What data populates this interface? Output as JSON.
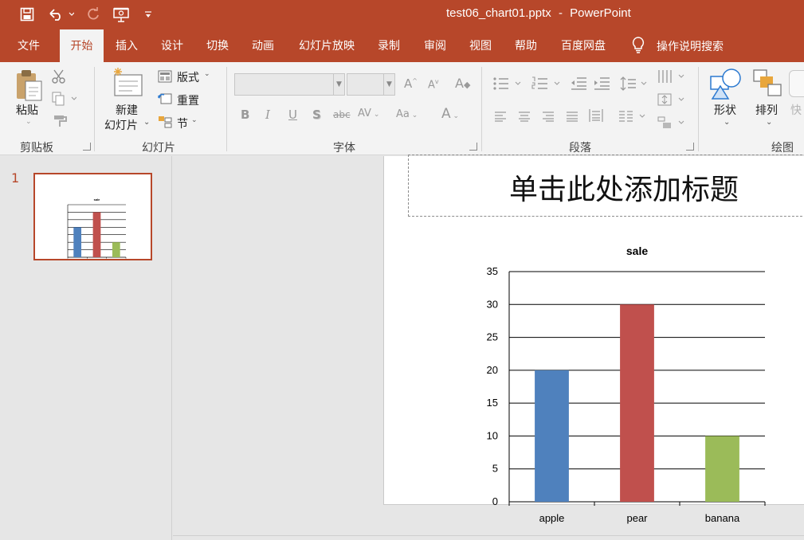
{
  "app": {
    "document_name": "test06_chart01.pptx",
    "separator": "-",
    "app_name": "PowerPoint"
  },
  "tabs": [
    {
      "label": "文件"
    },
    {
      "label": "开始",
      "active": true
    },
    {
      "label": "插入"
    },
    {
      "label": "设计"
    },
    {
      "label": "切换"
    },
    {
      "label": "动画"
    },
    {
      "label": "幻灯片放映"
    },
    {
      "label": "录制"
    },
    {
      "label": "审阅"
    },
    {
      "label": "视图"
    },
    {
      "label": "帮助"
    },
    {
      "label": "百度网盘"
    }
  ],
  "tell_me": {
    "label": "操作说明搜索",
    "icon": "lightbulb-icon"
  },
  "ribbon": {
    "clipboard": {
      "group_label": "剪贴板",
      "paste_label": "粘贴"
    },
    "slides": {
      "group_label": "幻灯片",
      "new_slide_line1": "新建",
      "new_slide_line2": "幻灯片",
      "layout_label": "版式",
      "reset_label": "重置",
      "section_label": "节"
    },
    "font": {
      "group_label": "字体"
    },
    "paragraph": {
      "group_label": "段落"
    },
    "drawing": {
      "group_label": "绘图",
      "shapes_label": "形状",
      "arrange_label": "排列",
      "quick_styles_label": "快"
    }
  },
  "thumbnails": [
    {
      "number": "1",
      "chart_title": "sale"
    }
  ],
  "slide": {
    "title_placeholder": "单击此处添加标题"
  },
  "chart_data": {
    "type": "bar",
    "title": "sale",
    "categories": [
      "apple",
      "pear",
      "banana"
    ],
    "values": [
      20,
      30,
      10
    ],
    "colors": [
      "#4f81bd",
      "#c0504d",
      "#9bbb59"
    ],
    "ylim": [
      0,
      35
    ],
    "yticks": [
      0,
      5,
      10,
      15,
      20,
      25,
      30,
      35
    ],
    "grid": true,
    "legend": "none"
  }
}
